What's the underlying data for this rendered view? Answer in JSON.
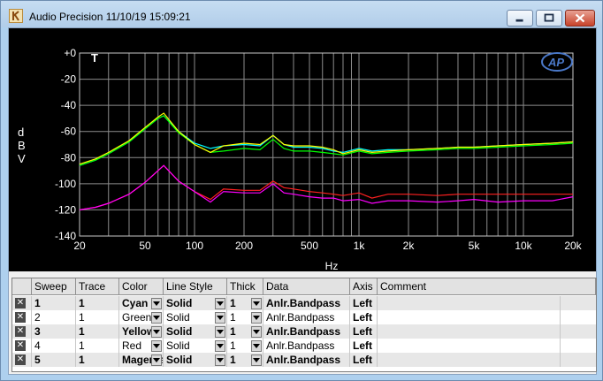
{
  "window": {
    "title": "Audio Precision  11/10/19 15:09:21",
    "buttons": {
      "minimize": "minimize",
      "restore": "restore",
      "close": "close"
    }
  },
  "plot": {
    "marker": "T",
    "logo": "AP",
    "ylabel_chars": [
      "d",
      "B",
      "V"
    ],
    "xunit": "Hz"
  },
  "chart_data": {
    "type": "line",
    "xlabel": "Hz",
    "ylabel": "dBV",
    "xscale": "log",
    "xlim": [
      20,
      20000
    ],
    "ylim": [
      -140,
      0
    ],
    "grid": true,
    "yticks": [
      "+0",
      "-20",
      "-40",
      "-60",
      "-80",
      "-100",
      "-120",
      "-140"
    ],
    "ytick_values": [
      0,
      -20,
      -40,
      -60,
      -80,
      -100,
      -120,
      -140
    ],
    "xticks": [
      "20",
      "50",
      "100",
      "200",
      "500",
      "1k",
      "2k",
      "5k",
      "10k",
      "20k"
    ],
    "xtick_values": [
      20,
      50,
      100,
      200,
      500,
      1000,
      2000,
      5000,
      10000,
      20000
    ],
    "series": [
      {
        "name": "1",
        "color": "#00ffff",
        "x": [
          20,
          25,
          30,
          40,
          50,
          60,
          65,
          80,
          100,
          125,
          150,
          200,
          250,
          300,
          350,
          400,
          500,
          600,
          700,
          800,
          1000,
          1200,
          1500,
          2000,
          3000,
          4000,
          5000,
          7000,
          10000,
          15000,
          20000
        ],
        "y": [
          -86,
          -82,
          -77,
          -68,
          -58,
          -50,
          -48,
          -60,
          -69,
          -73,
          -71,
          -70,
          -71,
          -63,
          -70,
          -72,
          -72,
          -73,
          -75,
          -76,
          -73,
          -75,
          -74,
          -74,
          -73,
          -72,
          -72,
          -71,
          -70,
          -69,
          -68
        ]
      },
      {
        "name": "2",
        "color": "#00ff00",
        "x": [
          20,
          25,
          30,
          40,
          50,
          60,
          65,
          80,
          100,
          125,
          150,
          200,
          250,
          300,
          350,
          400,
          500,
          600,
          700,
          800,
          1000,
          1200,
          1500,
          2000,
          3000,
          4000,
          5000,
          7000,
          10000,
          15000,
          20000
        ],
        "y": [
          -86,
          -82,
          -77,
          -68,
          -58,
          -50,
          -48,
          -61,
          -70,
          -76,
          -75,
          -73,
          -74,
          -66,
          -73,
          -75,
          -75,
          -76,
          -77,
          -78,
          -75,
          -77,
          -76,
          -75,
          -74,
          -73,
          -73,
          -72,
          -71,
          -70,
          -69
        ]
      },
      {
        "name": "3",
        "color": "#ffff00",
        "x": [
          20,
          25,
          30,
          40,
          50,
          60,
          65,
          80,
          100,
          125,
          150,
          200,
          250,
          300,
          350,
          400,
          500,
          600,
          700,
          800,
          1000,
          1200,
          1500,
          2000,
          3000,
          4000,
          5000,
          7000,
          10000,
          15000,
          20000
        ],
        "y": [
          -85,
          -81,
          -76,
          -67,
          -57,
          -49,
          -46,
          -60,
          -70,
          -76,
          -71,
          -69,
          -70,
          -63,
          -70,
          -71,
          -71,
          -72,
          -74,
          -77,
          -74,
          -76,
          -75,
          -74,
          -73,
          -72,
          -72,
          -71,
          -70,
          -69,
          -68
        ]
      },
      {
        "name": "4",
        "color": "#ff2020",
        "x": [
          20,
          25,
          30,
          40,
          50,
          60,
          65,
          80,
          100,
          125,
          150,
          200,
          250,
          300,
          350,
          400,
          500,
          600,
          700,
          800,
          1000,
          1200,
          1500,
          2000,
          3000,
          4000,
          5000,
          7000,
          10000,
          15000,
          20000
        ],
        "y": [
          -120,
          -118,
          -115,
          -108,
          -99,
          -90,
          -86,
          -98,
          -106,
          -112,
          -104,
          -105,
          -105,
          -98,
          -103,
          -104,
          -106,
          -107,
          -108,
          -109,
          -107,
          -111,
          -108,
          -108,
          -109,
          -108,
          -108,
          -108,
          -108,
          -108,
          -108
        ]
      },
      {
        "name": "5",
        "color": "#ff00ff",
        "x": [
          20,
          25,
          30,
          40,
          50,
          60,
          65,
          80,
          100,
          125,
          150,
          200,
          250,
          300,
          350,
          400,
          500,
          600,
          700,
          800,
          1000,
          1200,
          1500,
          2000,
          3000,
          4000,
          5000,
          7000,
          10000,
          15000,
          20000
        ],
        "y": [
          -120,
          -118,
          -115,
          -108,
          -99,
          -90,
          -86,
          -98,
          -106,
          -114,
          -106,
          -107,
          -107,
          -100,
          -107,
          -108,
          -110,
          -111,
          -111,
          -113,
          -112,
          -115,
          -113,
          -113,
          -114,
          -113,
          -112,
          -114,
          -113,
          -113,
          -110
        ]
      }
    ]
  },
  "table": {
    "headers": [
      "",
      "Sweep",
      "Trace",
      "Color",
      "Line Style",
      "Thick",
      "Data",
      "Axis",
      "Comment"
    ],
    "rows": [
      {
        "checked": true,
        "sweep": "1",
        "trace": "1",
        "color": "Cyan",
        "style": "Solid",
        "thick": "1",
        "data": "Anlr.Bandpass",
        "axis": "Left",
        "comment": "",
        "bold": true
      },
      {
        "checked": true,
        "sweep": "2",
        "trace": "1",
        "color": "Green",
        "style": "Solid",
        "thick": "1",
        "data": "Anlr.Bandpass",
        "axis": "Left",
        "comment": "",
        "bold": false
      },
      {
        "checked": true,
        "sweep": "3",
        "trace": "1",
        "color": "Yellow",
        "style": "Solid",
        "thick": "1",
        "data": "Anlr.Bandpass",
        "axis": "Left",
        "comment": "",
        "bold": true
      },
      {
        "checked": true,
        "sweep": "4",
        "trace": "1",
        "color": "Red",
        "style": "Solid",
        "thick": "1",
        "data": "Anlr.Bandpass",
        "axis": "Left",
        "comment": "",
        "bold": false
      },
      {
        "checked": true,
        "sweep": "5",
        "trace": "1",
        "color": "Magenta",
        "style": "Solid",
        "thick": "1",
        "data": "Anlr.Bandpass",
        "axis": "Left",
        "comment": "",
        "bold": true
      }
    ],
    "check_glyph": "✕"
  }
}
